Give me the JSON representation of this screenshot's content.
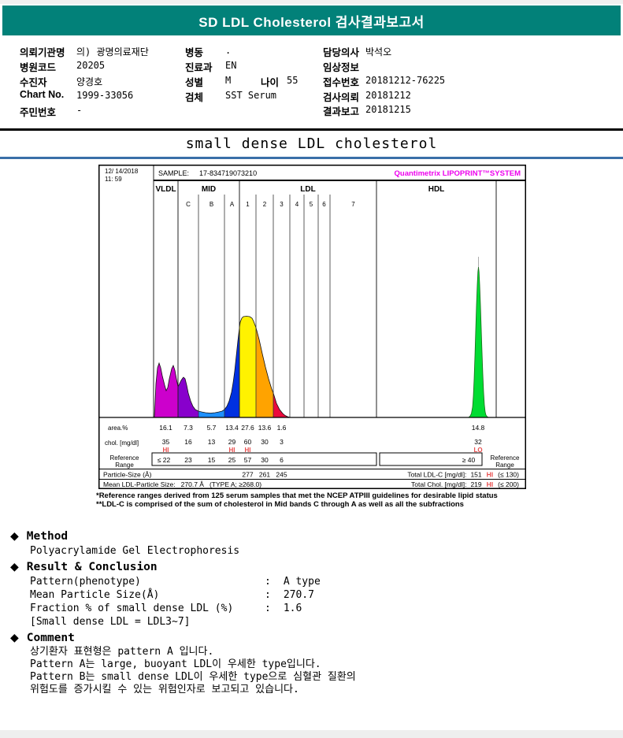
{
  "header": {
    "title": "SD LDL Cholesterol 검사결과보고서"
  },
  "patient": {
    "org_label": "의뢰기관명",
    "org_value": "의) 광명의료재단",
    "hospital_code_label": "병원코드",
    "hospital_code_value": "20205",
    "patient_label": "수진자",
    "patient_value": "양경호",
    "chart_no_label": "Chart No.",
    "chart_no_value": "1999-33056",
    "resident_id_label": "주민번호",
    "resident_id_value": "-",
    "ward_label": "병동",
    "ward_value": ".",
    "dept_label": "진료과",
    "dept_value": "EN",
    "sex_label": "성별",
    "sex_value": "M",
    "age_label": "나이",
    "age_value": "55",
    "specimen_label": "검체",
    "specimen_value": "SST Serum",
    "doctor_label": "담당의사",
    "doctor_value": "박석오",
    "clinical_info_label": "임상정보",
    "clinical_info_value": "",
    "accession_label": "접수번호",
    "accession_value": "20181212-76225",
    "order_date_label": "검사의뢰",
    "order_date_value": "20181212",
    "report_date_label": "결과보고",
    "report_date_value": "20181215"
  },
  "section_title": "small dense LDL cholesterol",
  "chart": {
    "date_line1": "12/ 14/2018",
    "date_line2": "11: 59",
    "sample_label": "SAMPLE:",
    "sample_value": "17-834719073210",
    "brand": "Quantimetrix LIPOPRINT™SYSTEM",
    "band_titles": [
      "VLDL",
      "MID",
      "LDL",
      "HDL"
    ],
    "sub_labels": [
      "C",
      "B",
      "A",
      "1",
      "2",
      "3",
      "4",
      "5",
      "6",
      "7"
    ],
    "table": {
      "area_label": "area.%",
      "area_values": [
        "16.1",
        "7.3",
        "5.7",
        "13.4",
        "27.6",
        "13.6",
        "1.6"
      ],
      "area_hdl": "14.8",
      "chol_label": "chol. [mg/dl]",
      "chol_values": [
        "35",
        "16",
        "13",
        "29",
        "60",
        "30",
        "3"
      ],
      "chol_flags": [
        "HI",
        "",
        "",
        "HI",
        "HI",
        "",
        ""
      ],
      "chol_hdl": "32",
      "chol_hdl_flag": "LO",
      "ref_label_1": "Reference",
      "ref_label_2": "Range",
      "ref_values": [
        "≤ 22",
        "23",
        "15",
        "25",
        "57",
        "30",
        "6"
      ],
      "ref_hdl": "≥ 40",
      "particle_label": "Particle-Size (Å)",
      "particle_values": [
        "277",
        "261",
        "245"
      ],
      "mean_label": "Mean LDL-Particle Size:",
      "mean_value": "270.7 Å",
      "mean_note": "(TYPE A; ≥268.0)",
      "total_ldl_label": "Total LDL-C [mg/dl]:",
      "total_ldl_value": "151",
      "total_ldl_flag": "HI",
      "total_ldl_ref": "(≤ 130)",
      "total_chol_label": "Total Chol. [mg/dl]:",
      "total_chol_value": "219",
      "total_chol_flag": "HI",
      "total_chol_ref": "(≤ 200)"
    },
    "footnotes": [
      "*Reference ranges derived from 125 serum samples that met the NCEP ATPIII guidelines for desirable lipid status",
      "**LDL-C is comprised of the sum of cholesterol in Mid bands C through A as well as all the subfractions"
    ]
  },
  "chart_data": {
    "type": "area",
    "sample": "17-834719073210",
    "datetime": "12/ 14/2018 11: 59",
    "instrument": "Quantimetrix LIPOPRINT SYSTEM",
    "bands": [
      "VLDL",
      "MID C",
      "MID B",
      "MID A",
      "LDL 1",
      "LDL 2",
      "LDL 3",
      "LDL 4",
      "LDL 5",
      "LDL 6",
      "LDL 7",
      "HDL"
    ],
    "area_pct": [
      16.1,
      7.3,
      5.7,
      13.4,
      27.6,
      13.6,
      1.6,
      null,
      null,
      null,
      null,
      14.8
    ],
    "chol_mg_dl": [
      35,
      16,
      13,
      29,
      60,
      30,
      3,
      null,
      null,
      null,
      null,
      32
    ],
    "flags": [
      "HI",
      "",
      "",
      "HI",
      "HI",
      "",
      "",
      "",
      "",
      "",
      "",
      "LO"
    ],
    "reference_range": [
      "≤22",
      "23",
      "15",
      "25",
      "57",
      "30",
      "6",
      "",
      "",
      "",
      "",
      "≥40"
    ],
    "particle_size_A": {
      "LDL1": 277,
      "LDL2": 261,
      "LDL3": 245
    },
    "mean_ldl_particle_size_A": 270.7,
    "pattern_type": "A",
    "total_ldl_c_mg_dl": 151,
    "total_chol_mg_dl": 219,
    "band_colors": [
      "#CC00CC",
      "#8800CC",
      "#1E90FF",
      "#0030E0",
      "#FFF200",
      "#FFA300",
      "#EC0A3C",
      "#00DC32"
    ]
  },
  "method": {
    "heading": "Method",
    "body": "Polyacrylamide Gel Electrophoresis"
  },
  "result": {
    "heading": "Result & Conclusion",
    "colon": ":",
    "rows": [
      {
        "label": "Pattern(phenotype)",
        "value": "A type"
      },
      {
        "label": "Mean Particle Size(Å)",
        "value": "270.7"
      },
      {
        "label": "Fraction % of small dense LDL (%)",
        "value": "1.6"
      }
    ],
    "note": "[Small dense LDL = LDL3~7]"
  },
  "comment": {
    "heading": "Comment",
    "lines": [
      "상기환자 표현형은 pattern A 입니다.",
      "Pattern A는 large, buoyant LDL이 우세한 type입니다.",
      "Pattern B는 small dense LDL이 우세한 type으로 심혈관 질환의",
      "위험도를 증가시킬 수 있는 위험인자로 보고되고 있습니다."
    ]
  },
  "ui": {
    "diamond": "◆"
  }
}
